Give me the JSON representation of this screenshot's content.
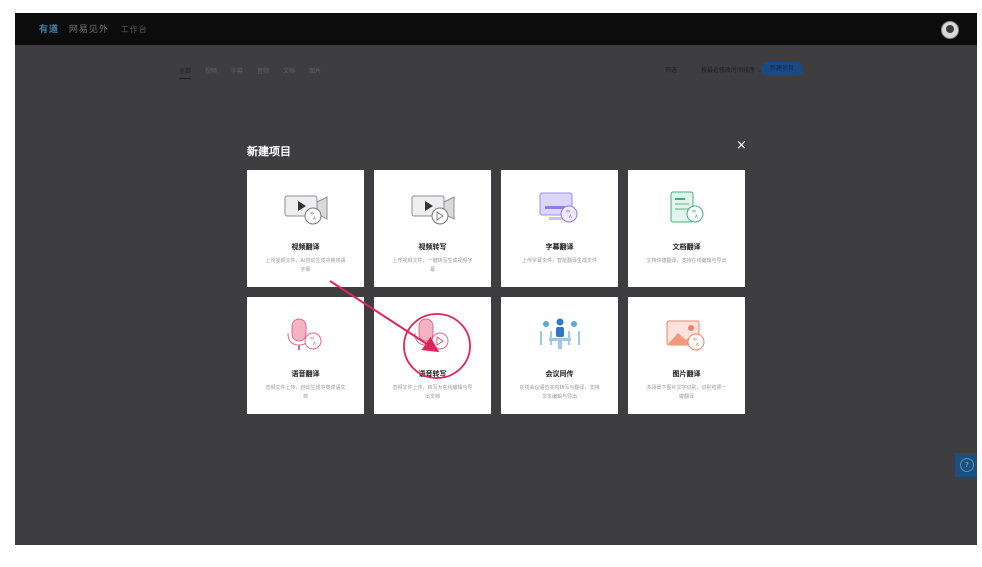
{
  "topbar": {
    "brand": "有道",
    "product": "网易见外",
    "workspace": "工作台"
  },
  "subnav": {
    "tabs": [
      "全部",
      "视频",
      "字幕",
      "音频",
      "文档",
      "图片"
    ]
  },
  "toolbar": {
    "filter": "筛选",
    "sort": "按最近修改时间排序",
    "new_button": "新建项目"
  },
  "help": {
    "label": "?"
  },
  "dialog": {
    "title": "新建项目",
    "close": "×",
    "cards": [
      {
        "title": "视频翻译",
        "desc": "上传视频文件，AI自动生成中英双语字幕",
        "icon": "video-translate-icon"
      },
      {
        "title": "视频转写",
        "desc": "上传视频文件，一键转写生成视频字幕",
        "icon": "video-transcribe-icon"
      },
      {
        "title": "字幕翻译",
        "desc": "上传字幕文件，智能翻译生成文件",
        "icon": "subtitle-translate-icon"
      },
      {
        "title": "文档翻译",
        "desc": "文档快捷翻译，支持在线编辑与导出",
        "icon": "document-translate-icon"
      },
      {
        "title": "语音翻译",
        "desc": "音频文件上传，自动生成中英双语文档",
        "icon": "voice-translate-icon"
      },
      {
        "title": "语音转写",
        "desc": "音频文件上传，转写为在线编辑与导出文档",
        "icon": "voice-transcribe-icon"
      },
      {
        "title": "会议同传",
        "desc": "在线会议语音实时转写与翻译，支持文本编辑与导出",
        "icon": "meeting-interpret-icon"
      },
      {
        "title": "图片翻译",
        "desc": "多场景下图片文字识别，识别结果一键翻译",
        "icon": "image-translate-icon"
      }
    ]
  },
  "colors": {
    "backdrop": "#3e3e40",
    "topbar": "#0c0c0d",
    "annotation": "#e0245e",
    "accent_blue": "#1a4a82"
  }
}
